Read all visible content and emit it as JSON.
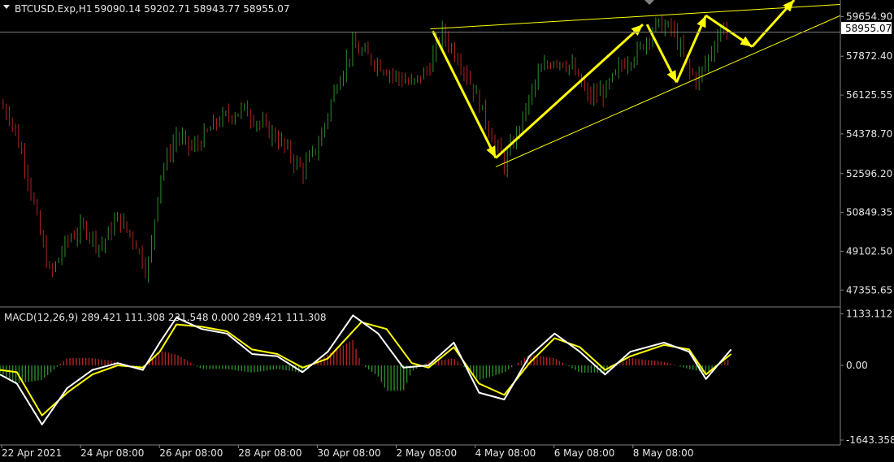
{
  "header": {
    "symbol": "BTCUSD.Exp,H1",
    "ohlc": "59090.14 59202.71 58943.77 58955.07"
  },
  "macd_header": "MACD(12,26,9) 289.421 111.308 231.548 0.000 289.421 111.308",
  "price_axis": {
    "ticks": [
      "59654.90",
      "57872.40",
      "56125.55",
      "54378.70",
      "52596.20",
      "50849.35",
      "49102.50",
      "47355.65"
    ],
    "tick_values": [
      59654.9,
      57872.4,
      56125.55,
      54378.7,
      52596.2,
      50849.35,
      49102.5,
      47355.65
    ],
    "current_price": "58955.07",
    "current_value": 58955.07
  },
  "macd_axis": {
    "ticks": [
      "1133.112",
      "0.00",
      "-1643.358"
    ],
    "tick_values": [
      1133.112,
      0,
      -1643.358
    ]
  },
  "time_axis": {
    "labels": [
      "22 Apr 2021",
      "24 Apr 08:00",
      "26 Apr 08:00",
      "28 Apr 08:00",
      "30 Apr 08:00",
      "2 May 08:00",
      "4 May 08:00",
      "6 May 08:00",
      "8 May 08:00"
    ]
  },
  "colors": {
    "background": "#000000",
    "bull_candle": "#2e8b2e",
    "bear_candle": "#b22222",
    "trendline": "#ffff00",
    "arrow": "#ffff00",
    "macd_line": "#ffffff",
    "signal_line": "#ffff00",
    "hist_pos": "#b22222",
    "hist_neg": "#2e8b2e",
    "grid_text": "#e6e6e6",
    "separator": "#808080"
  },
  "chart_data": {
    "type": "candlestick",
    "title": "BTCUSD.Exp,H1",
    "price_range": [
      46600,
      60400
    ],
    "price_path": [
      [
        0,
        55700
      ],
      [
        0.012,
        55200
      ],
      [
        0.03,
        53000
      ],
      [
        0.05,
        49500
      ],
      [
        0.06,
        48000
      ],
      [
        0.08,
        49600
      ],
      [
        0.1,
        50200
      ],
      [
        0.12,
        49300
      ],
      [
        0.14,
        50600
      ],
      [
        0.16,
        49600
      ],
      [
        0.175,
        48200
      ],
      [
        0.18,
        49300
      ],
      [
        0.19,
        52500
      ],
      [
        0.21,
        54300
      ],
      [
        0.23,
        53700
      ],
      [
        0.26,
        55000
      ],
      [
        0.29,
        55500
      ],
      [
        0.31,
        54800
      ],
      [
        0.33,
        54200
      ],
      [
        0.36,
        52700
      ],
      [
        0.38,
        54000
      ],
      [
        0.4,
        56600
      ],
      [
        0.42,
        58300
      ],
      [
        0.44,
        57800
      ],
      [
        0.47,
        57000
      ],
      [
        0.49,
        56600
      ],
      [
        0.51,
        57300
      ],
      [
        0.525,
        59000
      ],
      [
        0.55,
        57500
      ],
      [
        0.57,
        55800
      ],
      [
        0.585,
        54300
      ],
      [
        0.6,
        53000
      ],
      [
        0.62,
        54900
      ],
      [
        0.64,
        57000
      ],
      [
        0.66,
        57800
      ],
      [
        0.68,
        57400
      ],
      [
        0.7,
        56000
      ],
      [
        0.72,
        56300
      ],
      [
        0.74,
        57500
      ],
      [
        0.76,
        58100
      ],
      [
        0.78,
        59300
      ],
      [
        0.8,
        59100
      ],
      [
        0.82,
        57200
      ],
      [
        0.83,
        56800
      ],
      [
        0.845,
        58000
      ],
      [
        0.86,
        59300
      ],
      [
        0.865,
        58955
      ]
    ],
    "series": [
      {
        "name": "MACD",
        "values": [
          [
            0,
            -200
          ],
          [
            0.02,
            -400
          ],
          [
            0.05,
            -1300
          ],
          [
            0.08,
            -500
          ],
          [
            0.11,
            -100
          ],
          [
            0.14,
            50
          ],
          [
            0.17,
            -100
          ],
          [
            0.19,
            500
          ],
          [
            0.21,
            1050
          ],
          [
            0.24,
            800
          ],
          [
            0.27,
            700
          ],
          [
            0.3,
            250
          ],
          [
            0.33,
            200
          ],
          [
            0.36,
            -150
          ],
          [
            0.39,
            300
          ],
          [
            0.42,
            1100
          ],
          [
            0.45,
            700
          ],
          [
            0.48,
            -50
          ],
          [
            0.51,
            0
          ],
          [
            0.54,
            500
          ],
          [
            0.57,
            -600
          ],
          [
            0.6,
            -750
          ],
          [
            0.63,
            200
          ],
          [
            0.66,
            700
          ],
          [
            0.69,
            300
          ],
          [
            0.72,
            -200
          ],
          [
            0.75,
            300
          ],
          [
            0.79,
            500
          ],
          [
            0.82,
            300
          ],
          [
            0.84,
            -300
          ],
          [
            0.87,
            350
          ]
        ]
      },
      {
        "name": "Signal",
        "values": [
          [
            0,
            -100
          ],
          [
            0.02,
            -150
          ],
          [
            0.05,
            -1100
          ],
          [
            0.08,
            -600
          ],
          [
            0.11,
            -200
          ],
          [
            0.14,
            0
          ],
          [
            0.17,
            -50
          ],
          [
            0.19,
            300
          ],
          [
            0.21,
            900
          ],
          [
            0.24,
            850
          ],
          [
            0.27,
            750
          ],
          [
            0.3,
            350
          ],
          [
            0.33,
            250
          ],
          [
            0.36,
            -50
          ],
          [
            0.39,
            150
          ],
          [
            0.43,
            950
          ],
          [
            0.46,
            800
          ],
          [
            0.49,
            50
          ],
          [
            0.51,
            -50
          ],
          [
            0.54,
            400
          ],
          [
            0.57,
            -400
          ],
          [
            0.6,
            -650
          ],
          [
            0.63,
            50
          ],
          [
            0.66,
            600
          ],
          [
            0.69,
            400
          ],
          [
            0.72,
            -100
          ],
          [
            0.75,
            200
          ],
          [
            0.79,
            450
          ],
          [
            0.82,
            350
          ],
          [
            0.84,
            -200
          ],
          [
            0.87,
            250
          ]
        ]
      }
    ]
  }
}
